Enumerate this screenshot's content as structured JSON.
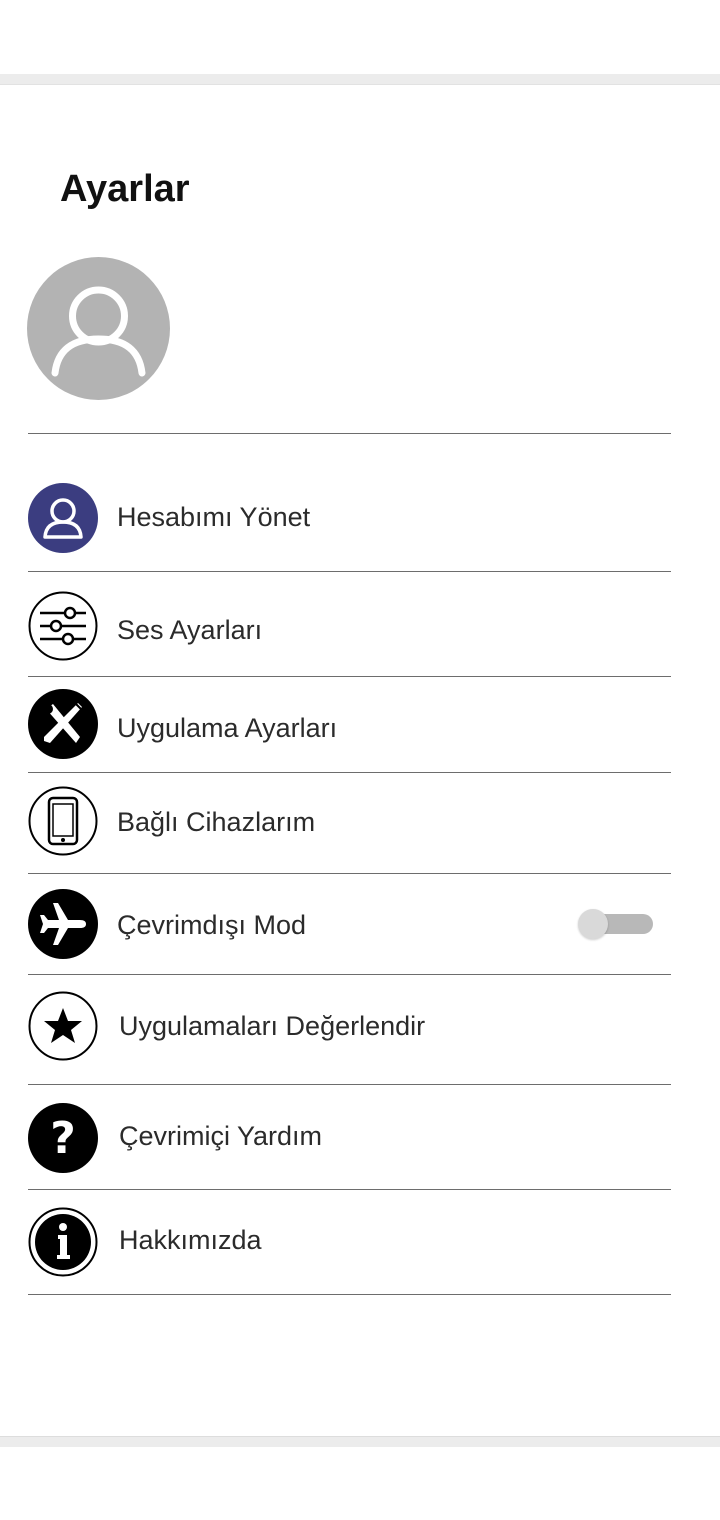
{
  "header": {
    "title": "Ayarlar"
  },
  "profile": {
    "avatar_icon": "user-avatar-icon"
  },
  "menu": {
    "items": [
      {
        "label": "Hesabımı Yönet",
        "icon": "user-icon",
        "icon_color": "#3b3d80"
      },
      {
        "label": "Ses Ayarları",
        "icon": "sliders-icon"
      },
      {
        "label": "Uygulama Ayarları",
        "icon": "tools-icon"
      },
      {
        "label": "Bağlı Cihazlarım",
        "icon": "phone-icon"
      },
      {
        "label": "Çevrimdışı Mod",
        "icon": "airplane-icon",
        "toggle": false
      },
      {
        "label": "Uygulamaları Değerlendir",
        "icon": "star-icon"
      },
      {
        "label": "Çevrimiçi Yardım",
        "icon": "question-icon"
      },
      {
        "label": "Hakkımızda",
        "icon": "info-icon"
      }
    ]
  }
}
